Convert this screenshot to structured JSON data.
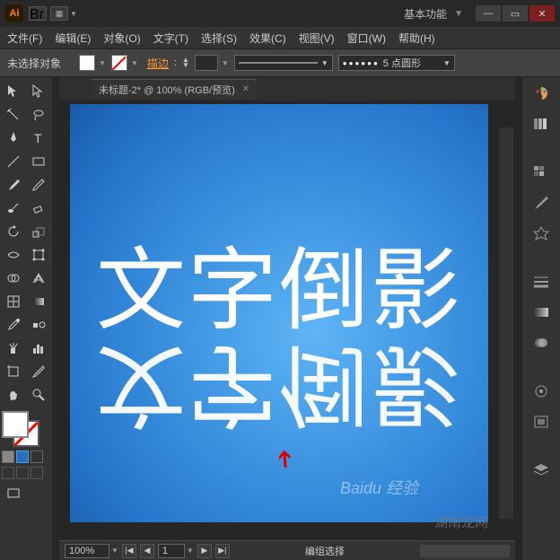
{
  "titlebar": {
    "workspace": "基本功能"
  },
  "menus": [
    "文件(F)",
    "编辑(E)",
    "对象(O)",
    "文字(T)",
    "选择(S)",
    "效果(C)",
    "视图(V)",
    "窗口(W)",
    "帮助(H)"
  ],
  "controlbar": {
    "selection_status": "未选择对象",
    "stroke_label": "描边",
    "stroke_weight": "",
    "brush_profile": "5 点圆形"
  },
  "doc_tab": {
    "title": "未标题-2* @ 100% (RGB/预览)"
  },
  "canvas": {
    "text_main": "文字倒影",
    "text_reflection": "文字倒影"
  },
  "statusbar": {
    "zoom": "100%",
    "page": "1",
    "mode": "编组选择"
  },
  "watermarks": {
    "baidu": "Baidu 经验",
    "site": "湖南龙网"
  }
}
